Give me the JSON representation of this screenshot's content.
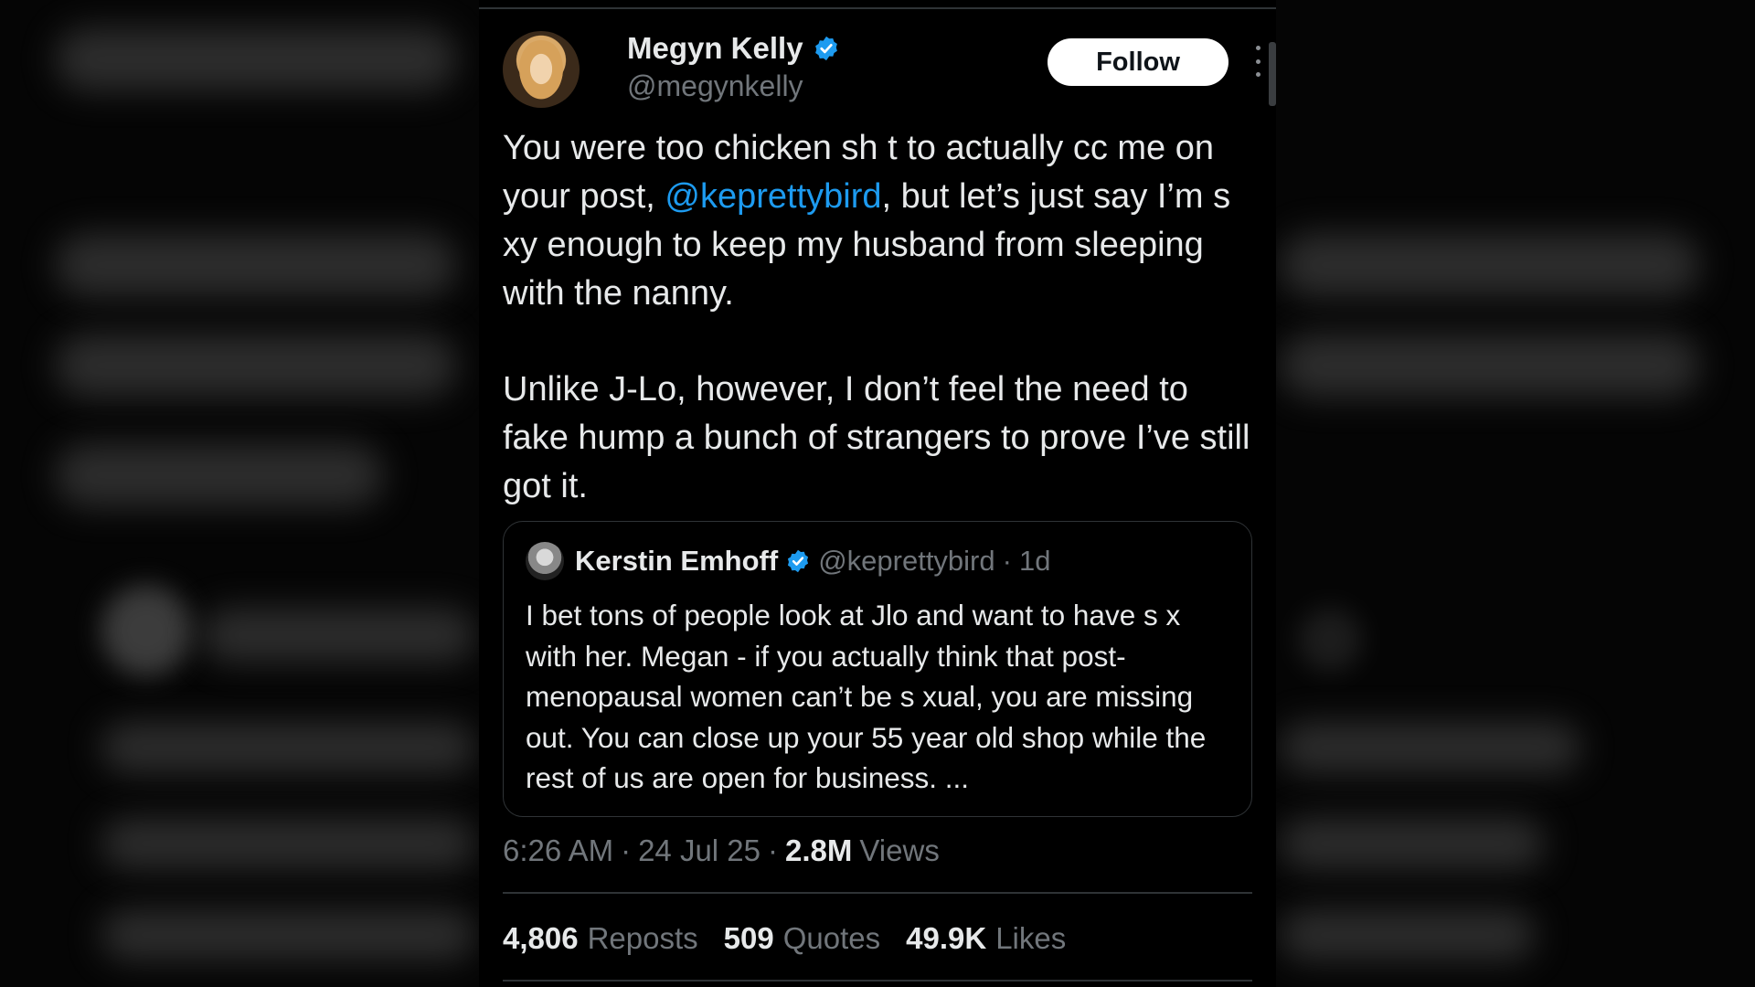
{
  "tweet": {
    "author_name": "Megyn Kelly",
    "author_handle": "@megynkelly",
    "follow_label": "Follow",
    "text_part1_before": "You were too chicken sh t to actually cc me on your post, ",
    "text_mention": "@keprettybird",
    "text_part1_after": ", but let’s just say I’m s  xy enough to keep my husband from sleeping with the nanny.",
    "text_part2": "Unlike J-Lo, however, I don’t feel the need to fake hump a bunch of strangers to prove I’ve still got it.",
    "time": "6:26 AM",
    "date": "24 Jul 25",
    "views_count": "2.8M",
    "views_label": "Views",
    "sep": "·"
  },
  "quote": {
    "name": "Kerstin Emhoff",
    "handle": "@keprettybird",
    "sep": "·",
    "age": "1d",
    "text": "I bet tons of people look at Jlo and want to have s  x with her. Megan - if you actually think that post-menopausal women can’t be s  xual, you are missing out. You can close up your 55 year old shop while the rest of us are open for business. ..."
  },
  "stats": {
    "reposts_count": "4,806",
    "reposts_label": "Reposts",
    "quotes_count": "509",
    "quotes_label": "Quotes",
    "likes_count": "49.9K",
    "likes_label": "Likes"
  },
  "colors": {
    "background": "#000000",
    "text": "#e7e9ea",
    "muted": "#71767b",
    "link": "#1d9bf0",
    "verified": "#1d9bf0",
    "border": "#2f3336"
  },
  "icons": {
    "verified": "verified-badge-icon",
    "more": "more-vertical-icon"
  }
}
